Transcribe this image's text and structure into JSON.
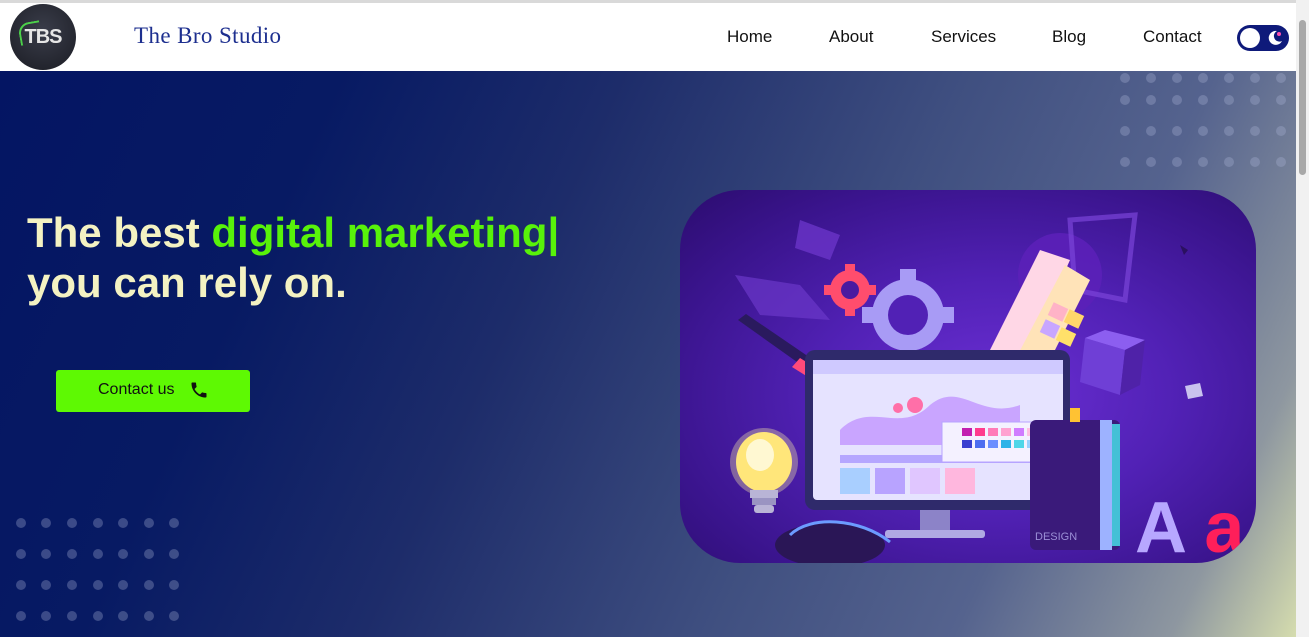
{
  "header": {
    "logo_text": "TBS",
    "brand": "The Bro Studio",
    "nav": [
      {
        "label": "Home"
      },
      {
        "label": "About"
      },
      {
        "label": "Services"
      },
      {
        "label": "Blog"
      },
      {
        "label": "Contact"
      }
    ],
    "theme_toggle_icon": "moon-icon"
  },
  "hero": {
    "headline_part1": "The best ",
    "headline_accent": "digital marketing",
    "headline_cursor": "|",
    "headline_line2": "you can rely on.",
    "cta_label": "Contact us",
    "cta_icon": "phone-icon",
    "illustration_text_design": "DESIGN",
    "illustration_text_aa": "Aa"
  },
  "colors": {
    "accent_green": "#58f20a",
    "headline_cream": "#f4f2c2",
    "brand_blue": "#1d2f8f",
    "hero_dark": "#041563"
  }
}
